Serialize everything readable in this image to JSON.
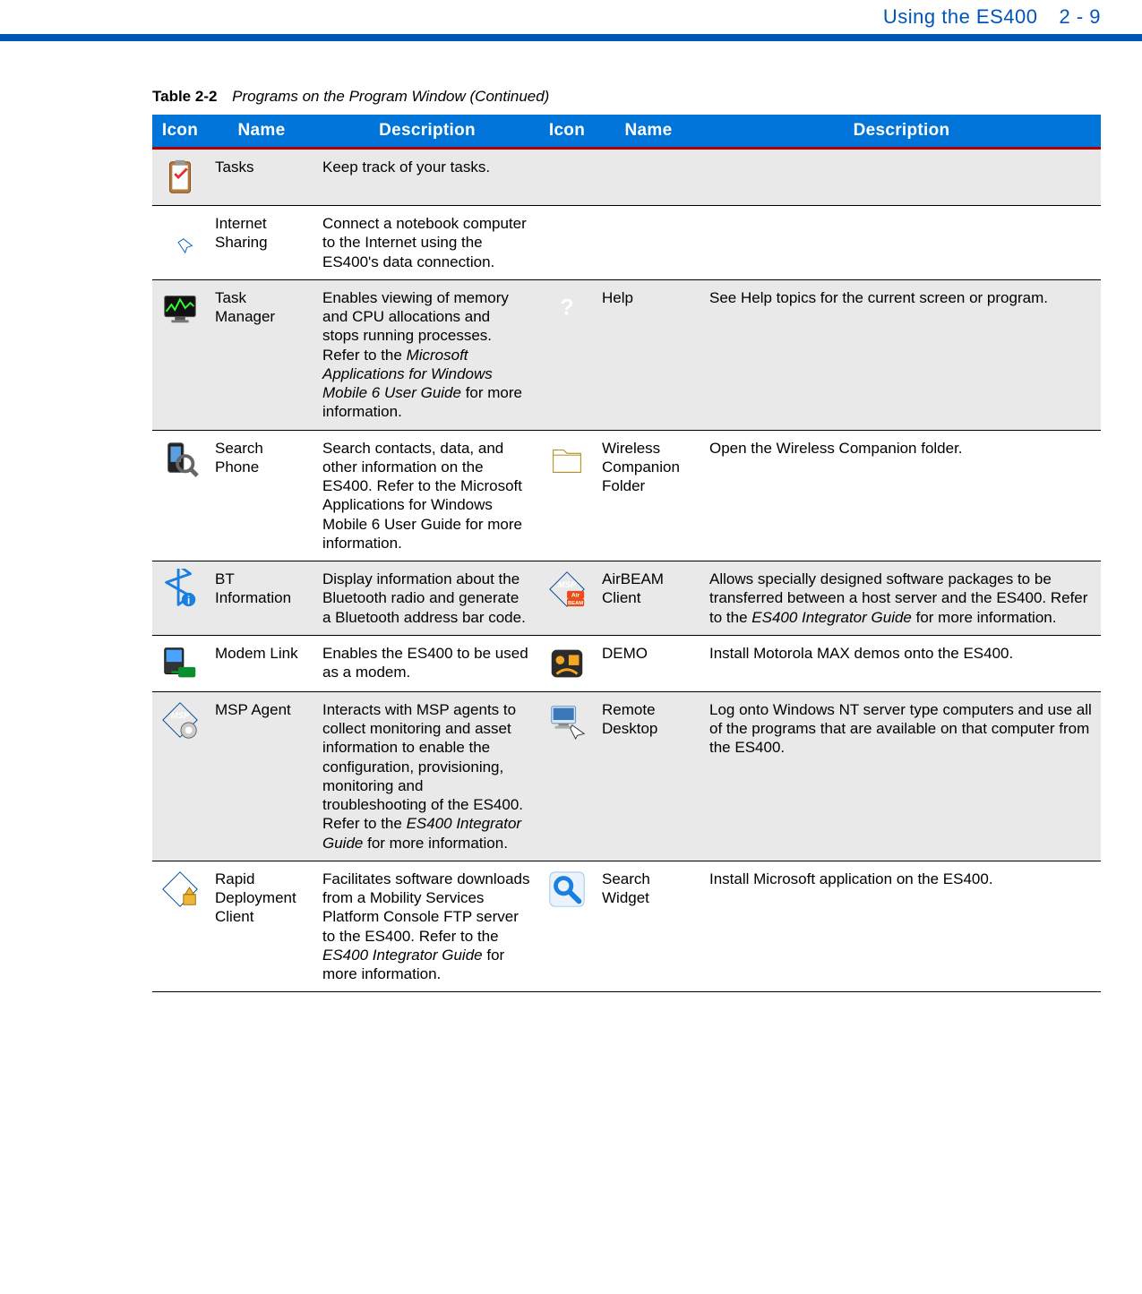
{
  "header": {
    "section": "Using the ES400",
    "page": "2 - 9"
  },
  "caption": {
    "label": "Table 2-2",
    "title": "Programs on the Program Window (Continued)"
  },
  "columns": [
    "Icon",
    "Name",
    "Description",
    "Icon",
    "Name",
    "Description"
  ],
  "rows": [
    {
      "left": {
        "icon": "tasks-icon",
        "name": "Tasks",
        "desc": "Keep track of your tasks."
      },
      "right": null
    },
    {
      "left": {
        "icon": "internet-sharing-icon",
        "name": "Internet Sharing",
        "desc": "Connect a notebook computer to the Internet using the ES400's data connection."
      },
      "right": null
    },
    {
      "left": {
        "icon": "task-manager-icon",
        "name": "Task Manager",
        "desc": "Enables viewing of memory and CPU allocations and stops running processes. Refer to the *Microsoft Applications for Windows Mobile 6 User Guide* for more information."
      },
      "right": {
        "icon": "help-icon",
        "name": "Help",
        "desc": "See Help topics for the current screen or program."
      }
    },
    {
      "left": {
        "icon": "search-phone-icon",
        "name": "Search Phone",
        "desc": "Search contacts, data, and other information on the ES400. Refer to the Microsoft Applications for Windows Mobile 6 User Guide for more information."
      },
      "right": {
        "icon": "wireless-companion-folder-icon",
        "name": "Wireless Companion Folder",
        "desc": "Open the Wireless Companion folder."
      }
    },
    {
      "left": {
        "icon": "bt-information-icon",
        "name": "BT Information",
        "desc": "Display information about the Bluetooth radio and generate a Bluetooth address bar code."
      },
      "right": {
        "icon": "airbeam-client-icon",
        "name": "AirBEAM Client",
        "desc": "Allows specially designed software packages to be transferred between a host server and the ES400. Refer to the *ES400 Integrator Guide* for more information."
      }
    },
    {
      "left": {
        "icon": "modem-link-icon",
        "name": "Modem Link",
        "desc": "Enables the ES400 to be used as a modem."
      },
      "right": {
        "icon": "demo-icon",
        "name": "DEMO",
        "desc": "Install Motorola MAX demos onto the ES400."
      }
    },
    {
      "left": {
        "icon": "msp-agent-icon",
        "name": "MSP Agent",
        "desc": "Interacts with MSP agents to collect monitoring and asset information to enable the configuration, provisioning, monitoring and troubleshooting of the ES400. Refer to the *ES400 Integrator Guide* for more information."
      },
      "right": {
        "icon": "remote-desktop-icon",
        "name": "Remote Desktop",
        "desc": "Log onto Windows NT server type computers and use all of the programs that are available on that computer from the ES400."
      }
    },
    {
      "left": {
        "icon": "rapid-deployment-client-icon",
        "name": "Rapid Deployment Client",
        "desc": "Facilitates software downloads from a Mobility Services Platform Console FTP server to the ES400. Refer to the *ES400 Integrator Guide* for more information."
      },
      "right": {
        "icon": "search-widget-icon",
        "name": "Search Widget",
        "desc": "Install Microsoft application on the ES400."
      }
    }
  ]
}
